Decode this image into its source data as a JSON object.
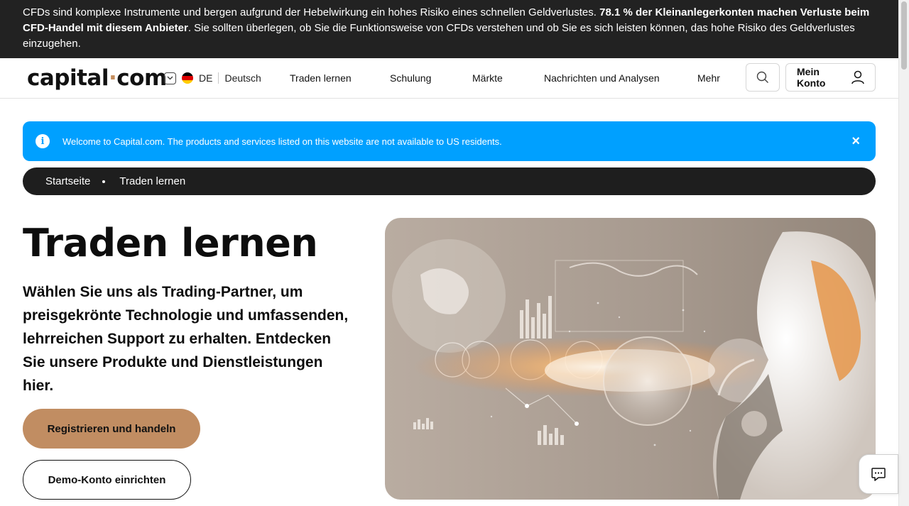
{
  "risk_banner": {
    "text_before": "CFDs sind komplexe Instrumente und bergen aufgrund der Hebelwirkung ein hohes Risiko eines schnellen Geldverlustes. ",
    "text_bold": "78.1 % der Kleinanlegerkonten machen Verluste beim CFD-Handel mit diesem Anbieter",
    "text_after": ". Sie sollten überlegen, ob Sie die Funktionsweise von CFDs verstehen und ob Sie es sich leisten können, das hohe Risiko des Geldverlustes einzugehen."
  },
  "header": {
    "logo_left": "capital",
    "logo_dot": "·",
    "logo_right": "com",
    "lang_code": "DE",
    "lang_name": "Deutsch",
    "nav": [
      "Traden lernen",
      "Schulung",
      "Märkte",
      "Nachrichten und Analysen",
      "Mehr"
    ],
    "account_label": "Mein Konto",
    "icons": {
      "search": "search-icon",
      "account": "user-icon",
      "lang": "chevron-down-icon"
    }
  },
  "info_banner": {
    "text": "Welcome to Capital.com. The products and services listed on this website are not available to US residents.",
    "close": "×",
    "icon_glyph": "i"
  },
  "breadcrumb": [
    "Startseite",
    "Traden lernen"
  ],
  "hero": {
    "title": "Traden lernen",
    "subtitle": "Wählen Sie uns als Trading-Partner, um preisgekrönte Technologie und umfassenden, lehrreichen Support zu erhalten. Entdecken Sie unsere Produkte und Dienstleistungen hier.",
    "register_button": "Registrieren und handeln",
    "demo_button": "Demo-Konto einrichten"
  },
  "colors": {
    "risk_banner_bg": "#222222",
    "info_banner_bg": "#00a0ff",
    "breadcrumb_bg": "#1e1e1e",
    "accent": "#c18d62"
  }
}
